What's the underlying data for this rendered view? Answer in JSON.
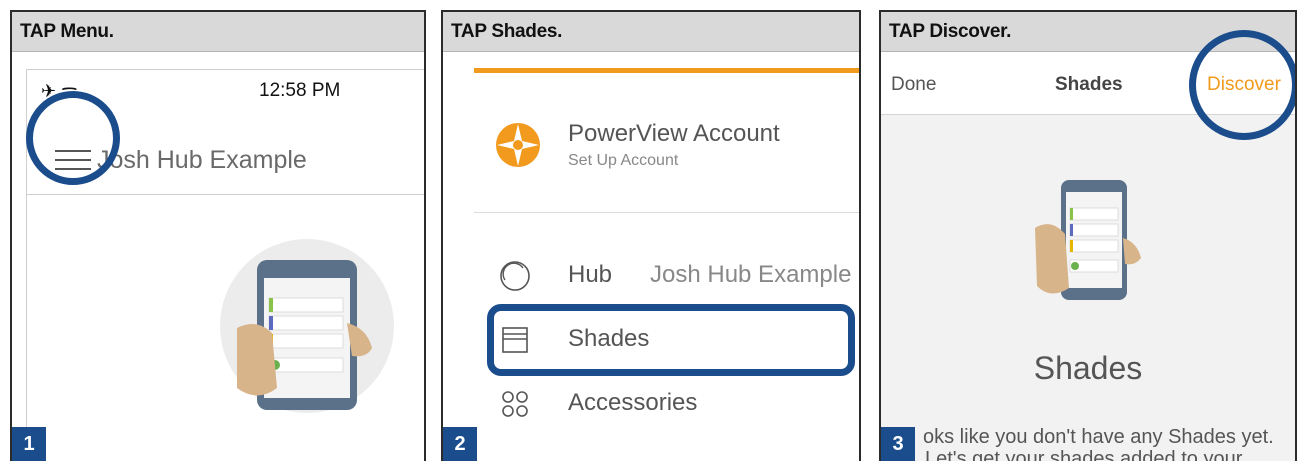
{
  "panels": [
    {
      "header": "TAP Menu.",
      "step": "1"
    },
    {
      "header": "TAP Shades.",
      "step": "2"
    },
    {
      "header": "TAP Discover.",
      "step": "3"
    }
  ],
  "panel1": {
    "status": {
      "time": "12:58 PM",
      "icons": "✈ ᯤ"
    },
    "hub_title": "Josh Hub Example"
  },
  "panel2": {
    "account": {
      "title": "PowerView Account",
      "subtitle": "Set Up Account"
    },
    "menu": [
      {
        "label": "Hub",
        "value": "Josh Hub Example",
        "icon": "hub-circle-icon"
      },
      {
        "label": "Shades",
        "icon": "shades-icon"
      },
      {
        "label": "Accessories",
        "icon": "accessories-icon"
      }
    ]
  },
  "panel3": {
    "nav": {
      "done": "Done",
      "title": "Shades",
      "discover": "Discover"
    },
    "heading": "Shades",
    "message_line1": "oks like you don't have any Shades yet.",
    "message_line2": "Let's get your shades added to your"
  },
  "colors": {
    "accent_blue": "#1b4d8c",
    "orange": "#f29a1e",
    "header_gray": "#d9d9d9"
  }
}
